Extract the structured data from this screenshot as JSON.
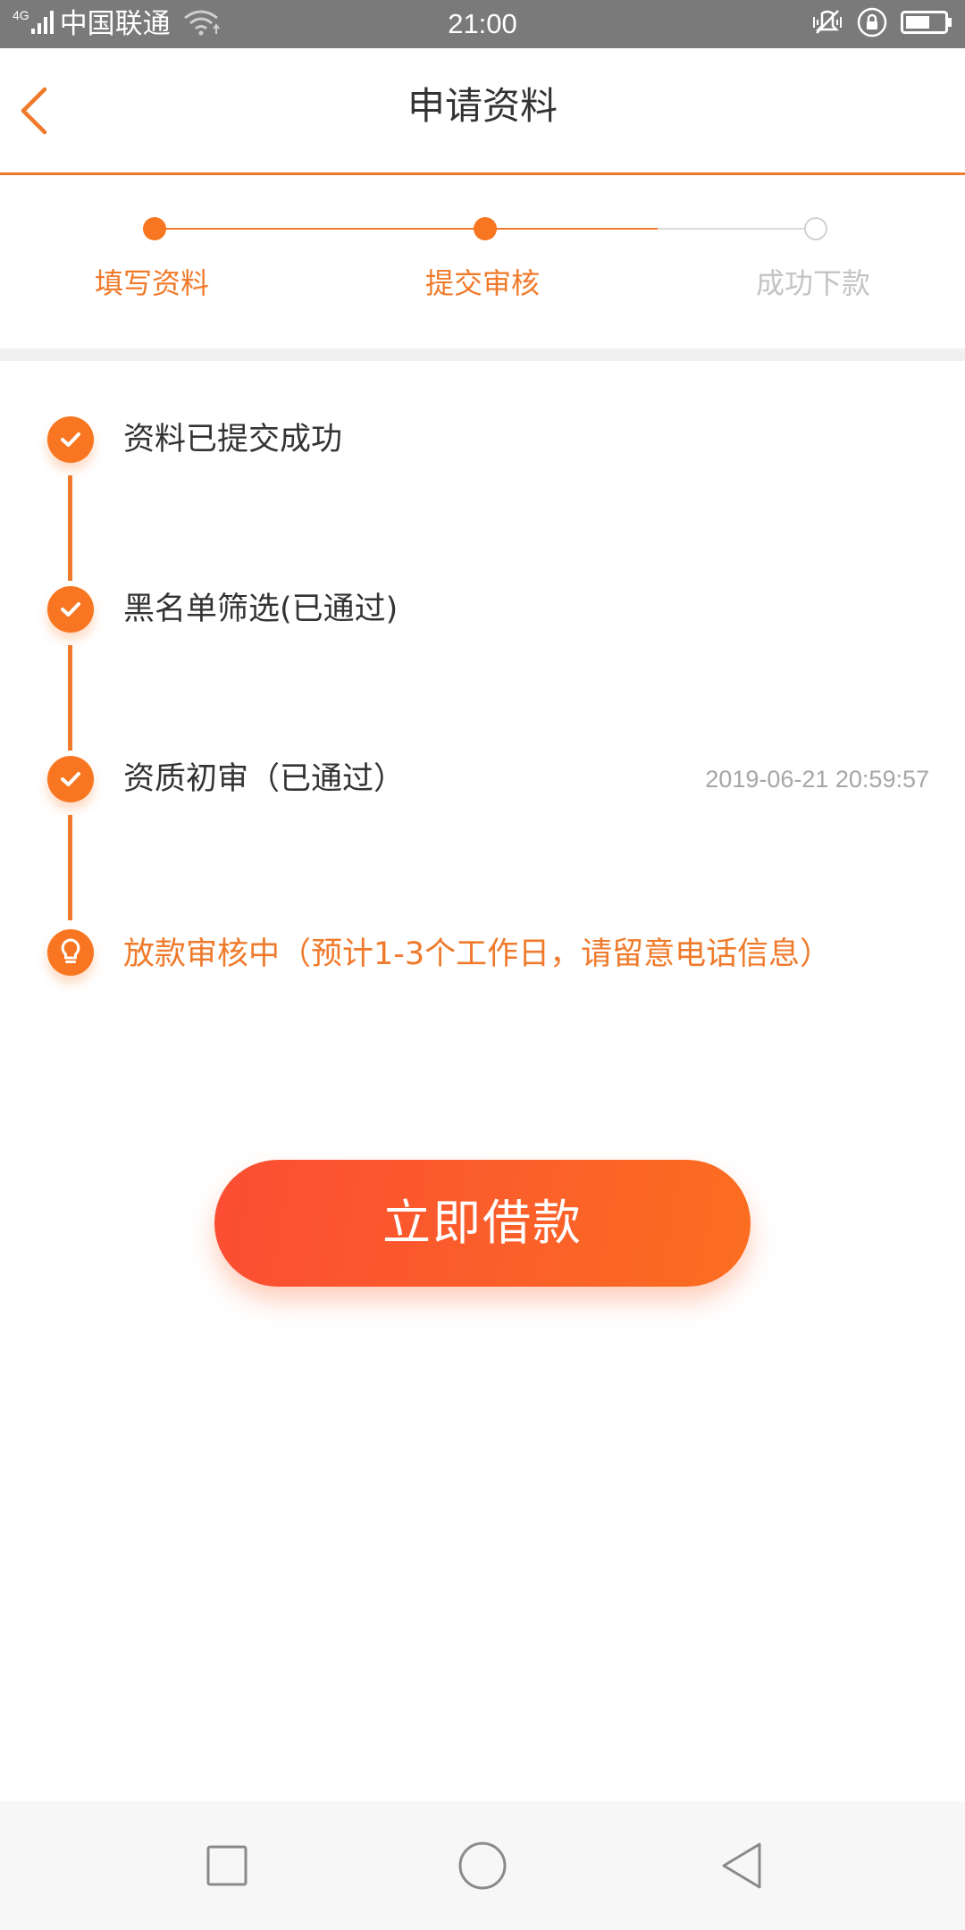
{
  "status_bar": {
    "network": "4G",
    "carrier": "中国联通",
    "time": "21:00",
    "icons": [
      "signal-icon",
      "wifi-icon",
      "vibrate-mute-icon",
      "rotation-lock-icon",
      "battery-icon"
    ]
  },
  "header": {
    "title": "申请资料",
    "back_icon": "chevron-left-icon"
  },
  "steps": [
    {
      "label": "填写资料",
      "state": "done"
    },
    {
      "label": "提交审核",
      "state": "done"
    },
    {
      "label": "成功下款",
      "state": "todo"
    }
  ],
  "timeline": [
    {
      "text": "资料已提交成功",
      "time": "",
      "icon": "check-icon",
      "state": "done"
    },
    {
      "text": "黑名单筛选(已通过)",
      "time": "",
      "icon": "check-icon",
      "state": "done"
    },
    {
      "text": "资质初审（已通过）",
      "time": "2019-06-21 20:59:57",
      "icon": "check-icon",
      "state": "done"
    },
    {
      "text": "放款审核中（预计1-3个工作日，请留意电话信息）",
      "time": "",
      "icon": "lightbulb-icon",
      "state": "active"
    }
  ],
  "borrow_button": {
    "label": "立即借款"
  },
  "nav_bar": {
    "icons": [
      "recent-apps-icon",
      "home-icon",
      "back-icon"
    ]
  },
  "colors": {
    "accent": "#f07a2b",
    "accent_dot": "#f87621",
    "inactive": "#c4c4c4",
    "button_start": "#fb4d33",
    "button_end": "#fb6e20"
  }
}
